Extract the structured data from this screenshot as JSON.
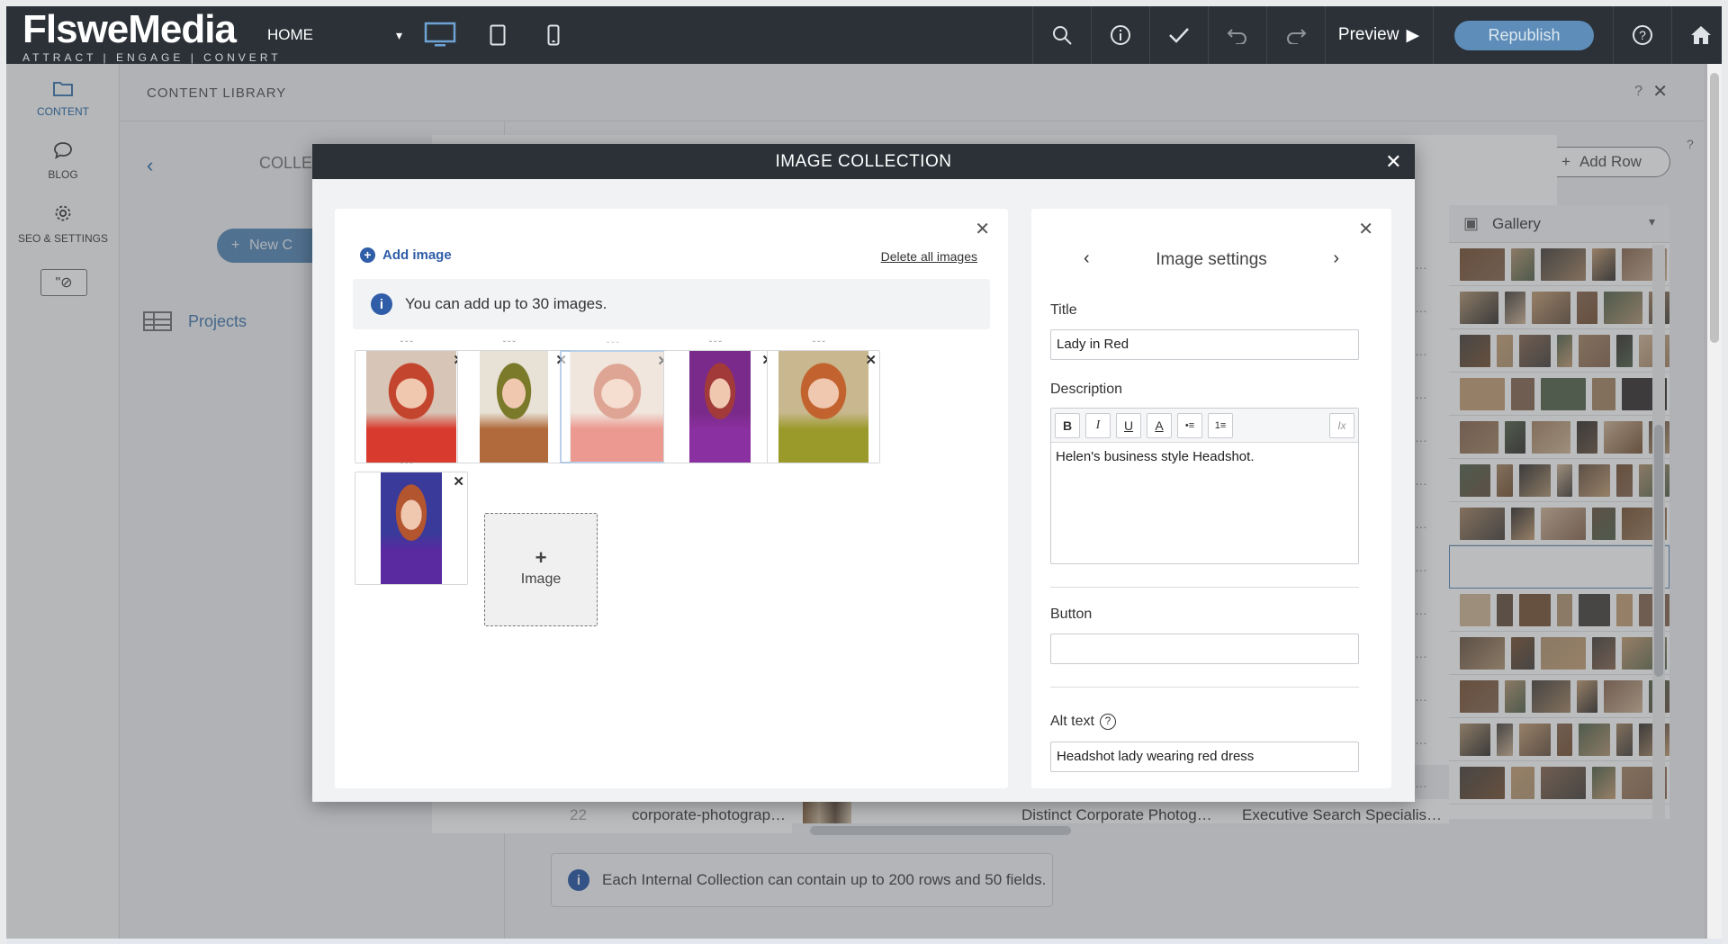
{
  "app": {
    "logo_name": "FlsweMedia",
    "logo_tagline": "ATTRACT | ENGAGE | CONVERT",
    "page_select": "HOME",
    "preview_label": "Preview",
    "republish_label": "Republish"
  },
  "icons": {
    "desktop": "desktop-icon",
    "tablet": "tablet-icon",
    "mobile": "mobile-icon",
    "search": "search-icon",
    "info": "info-icon",
    "check": "check-icon",
    "undo": "undo-icon",
    "redo": "redo-icon",
    "help": "help-icon",
    "home": "home-icon"
  },
  "leftnav": {
    "items": [
      {
        "label": "CONTENT",
        "icon": "folder-icon"
      },
      {
        "label": "BLOG",
        "icon": "chat-bubble-icon"
      },
      {
        "label": "SEO & SETTINGS",
        "icon": "gear-icon"
      }
    ]
  },
  "library": {
    "title": "CONTENT LIBRARY",
    "help": "?",
    "collections_label": "COLLEC",
    "new_button": "New C",
    "projects_label": "Projects",
    "add_row_label": "Add Row",
    "gallery_header": "Gallery",
    "row22": {
      "number": "22",
      "slug": "corporate-photograp…",
      "description": "Distinct Corporate Photog…",
      "extra": "Executive Search Specialis…"
    },
    "note": "Each Internal Collection can contain up to 200 rows and 50 fields."
  },
  "modal": {
    "title": "IMAGE COLLECTION",
    "add_image_label": "Add image",
    "delete_all_label": "Delete all images",
    "limit_note": "You can add up to 30 images.",
    "add_tile_label": "Image",
    "images": [
      {
        "colors": [
          "#d7c6b8",
          "#c4452e",
          "#d83a2d",
          "#e2d0c0"
        ]
      },
      {
        "colors": [
          "#e8e2d6",
          "#7b7a2a",
          "#b06a3c",
          "#efe9df"
        ]
      },
      {
        "colors": [
          "#e8d7c8",
          "#c96a4e",
          "#e0574a",
          "#f1e6dc"
        ]
      },
      {
        "colors": [
          "#7a2a8a",
          "#a23a3a",
          "#8a30a0",
          "#5e1f6e"
        ]
      },
      {
        "colors": [
          "#c9b88f",
          "#c2632f",
          "#9a9a2a",
          "#b9a778"
        ]
      },
      {
        "colors": [
          "#3a3a9a",
          "#b3552f",
          "#5a2aa0",
          "#7a6a6a"
        ]
      }
    ]
  },
  "settings": {
    "title": "Image settings",
    "title_label": "Title",
    "title_value": "Lady in Red",
    "description_label": "Description",
    "description_value": "Helen's business style Headshot.",
    "button_label": "Button",
    "button_value": "",
    "alt_label": "Alt text",
    "alt_value": "Headshot lady wearing red dress",
    "toolbar": [
      "B",
      "I",
      "U",
      "A",
      "•≡",
      "1≡",
      "Ix"
    ]
  }
}
